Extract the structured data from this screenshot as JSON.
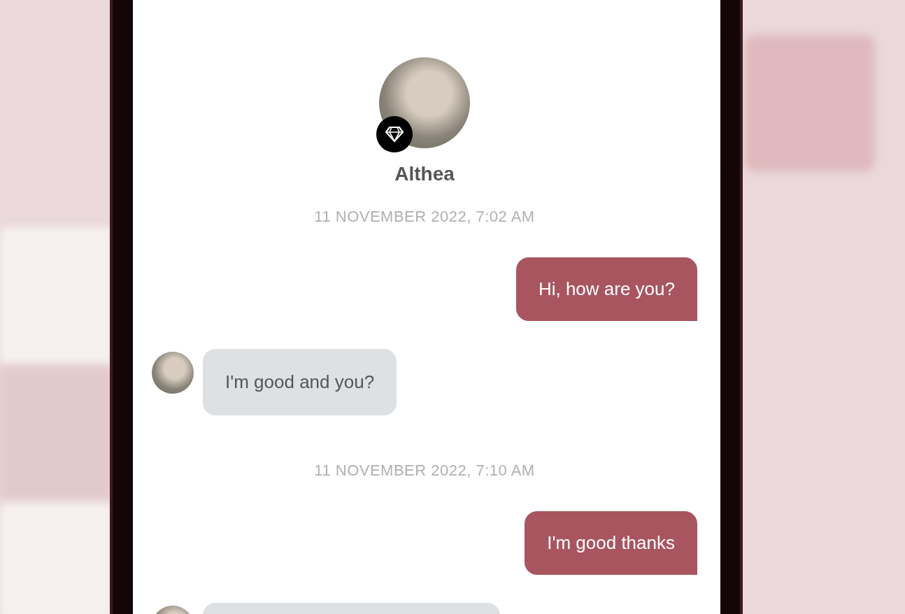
{
  "profile": {
    "name": "Althea",
    "premium": true
  },
  "messages": [
    {
      "kind": "timestamp",
      "text": "11 NOVEMBER 2022, 7:02 AM"
    },
    {
      "kind": "sent",
      "text": "Hi, how are you?"
    },
    {
      "kind": "received",
      "text": "I'm good and you?"
    },
    {
      "kind": "timestamp",
      "text": "11 NOVEMBER 2022, 7:10 AM"
    },
    {
      "kind": "sent",
      "text": "I'm good thanks"
    },
    {
      "kind": "received"
    }
  ]
}
